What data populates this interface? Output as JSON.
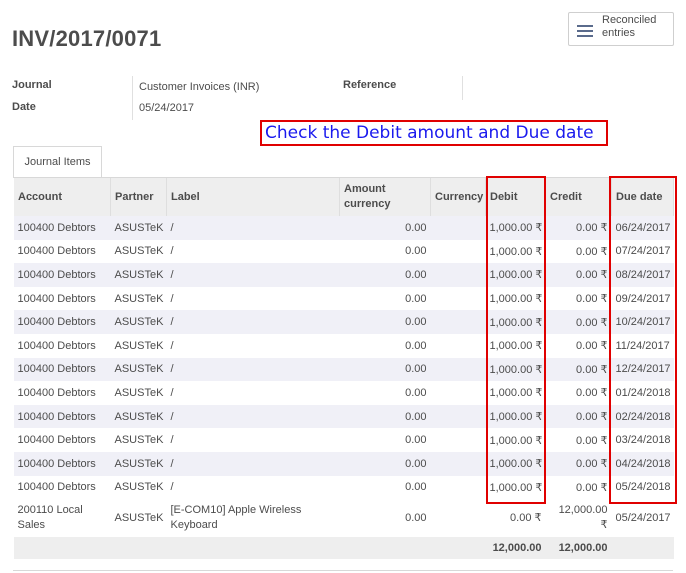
{
  "header": {
    "title": "INV/2017/0071",
    "reconciled_button_label": "Reconciled entries"
  },
  "fields": {
    "journal_label": "Journal",
    "journal_value": "Customer Invoices (INR)",
    "date_label": "Date",
    "date_value": "05/24/2017",
    "reference_label": "Reference",
    "reference_value": ""
  },
  "annotation": "Check the Debit amount and Due date",
  "tabs": [
    {
      "label": "Journal Items"
    }
  ],
  "table": {
    "columns": [
      "Account",
      "Partner",
      "Label",
      "Amount currency",
      "Currency",
      "Debit",
      "Credit",
      "Due date"
    ],
    "rows": [
      [
        "100400 Debtors",
        "ASUSTeK",
        "/",
        "0.00",
        "",
        "1,000.00 ₹",
        "0.00 ₹",
        "06/24/2017"
      ],
      [
        "100400 Debtors",
        "ASUSTeK",
        "/",
        "0.00",
        "",
        "1,000.00 ₹",
        "0.00 ₹",
        "07/24/2017"
      ],
      [
        "100400 Debtors",
        "ASUSTeK",
        "/",
        "0.00",
        "",
        "1,000.00 ₹",
        "0.00 ₹",
        "08/24/2017"
      ],
      [
        "100400 Debtors",
        "ASUSTeK",
        "/",
        "0.00",
        "",
        "1,000.00 ₹",
        "0.00 ₹",
        "09/24/2017"
      ],
      [
        "100400 Debtors",
        "ASUSTeK",
        "/",
        "0.00",
        "",
        "1,000.00 ₹",
        "0.00 ₹",
        "10/24/2017"
      ],
      [
        "100400 Debtors",
        "ASUSTeK",
        "/",
        "0.00",
        "",
        "1,000.00 ₹",
        "0.00 ₹",
        "11/24/2017"
      ],
      [
        "100400 Debtors",
        "ASUSTeK",
        "/",
        "0.00",
        "",
        "1,000.00 ₹",
        "0.00 ₹",
        "12/24/2017"
      ],
      [
        "100400 Debtors",
        "ASUSTeK",
        "/",
        "0.00",
        "",
        "1,000.00 ₹",
        "0.00 ₹",
        "01/24/2018"
      ],
      [
        "100400 Debtors",
        "ASUSTeK",
        "/",
        "0.00",
        "",
        "1,000.00 ₹",
        "0.00 ₹",
        "02/24/2018"
      ],
      [
        "100400 Debtors",
        "ASUSTeK",
        "/",
        "0.00",
        "",
        "1,000.00 ₹",
        "0.00 ₹",
        "03/24/2018"
      ],
      [
        "100400 Debtors",
        "ASUSTeK",
        "/",
        "0.00",
        "",
        "1,000.00 ₹",
        "0.00 ₹",
        "04/24/2018"
      ],
      [
        "100400 Debtors",
        "ASUSTeK",
        "/",
        "0.00",
        "",
        "1,000.00 ₹",
        "0.00 ₹",
        "05/24/2018"
      ],
      [
        "200110 Local Sales",
        "ASUSTeK",
        "[E-COM10] Apple Wireless Keyboard",
        "0.00",
        "",
        "0.00 ₹",
        "12,000.00 ₹",
        "05/24/2017"
      ]
    ],
    "totals": {
      "debit": "12,000.00",
      "credit": "12,000.00"
    }
  },
  "colors": {
    "annotation_border": "#e00000",
    "annotation_text": "#1a1aee",
    "row_stripe": "#f0f0f7",
    "header_bg": "#eeeeee"
  },
  "icons": {
    "reconciled": "list-icon"
  }
}
